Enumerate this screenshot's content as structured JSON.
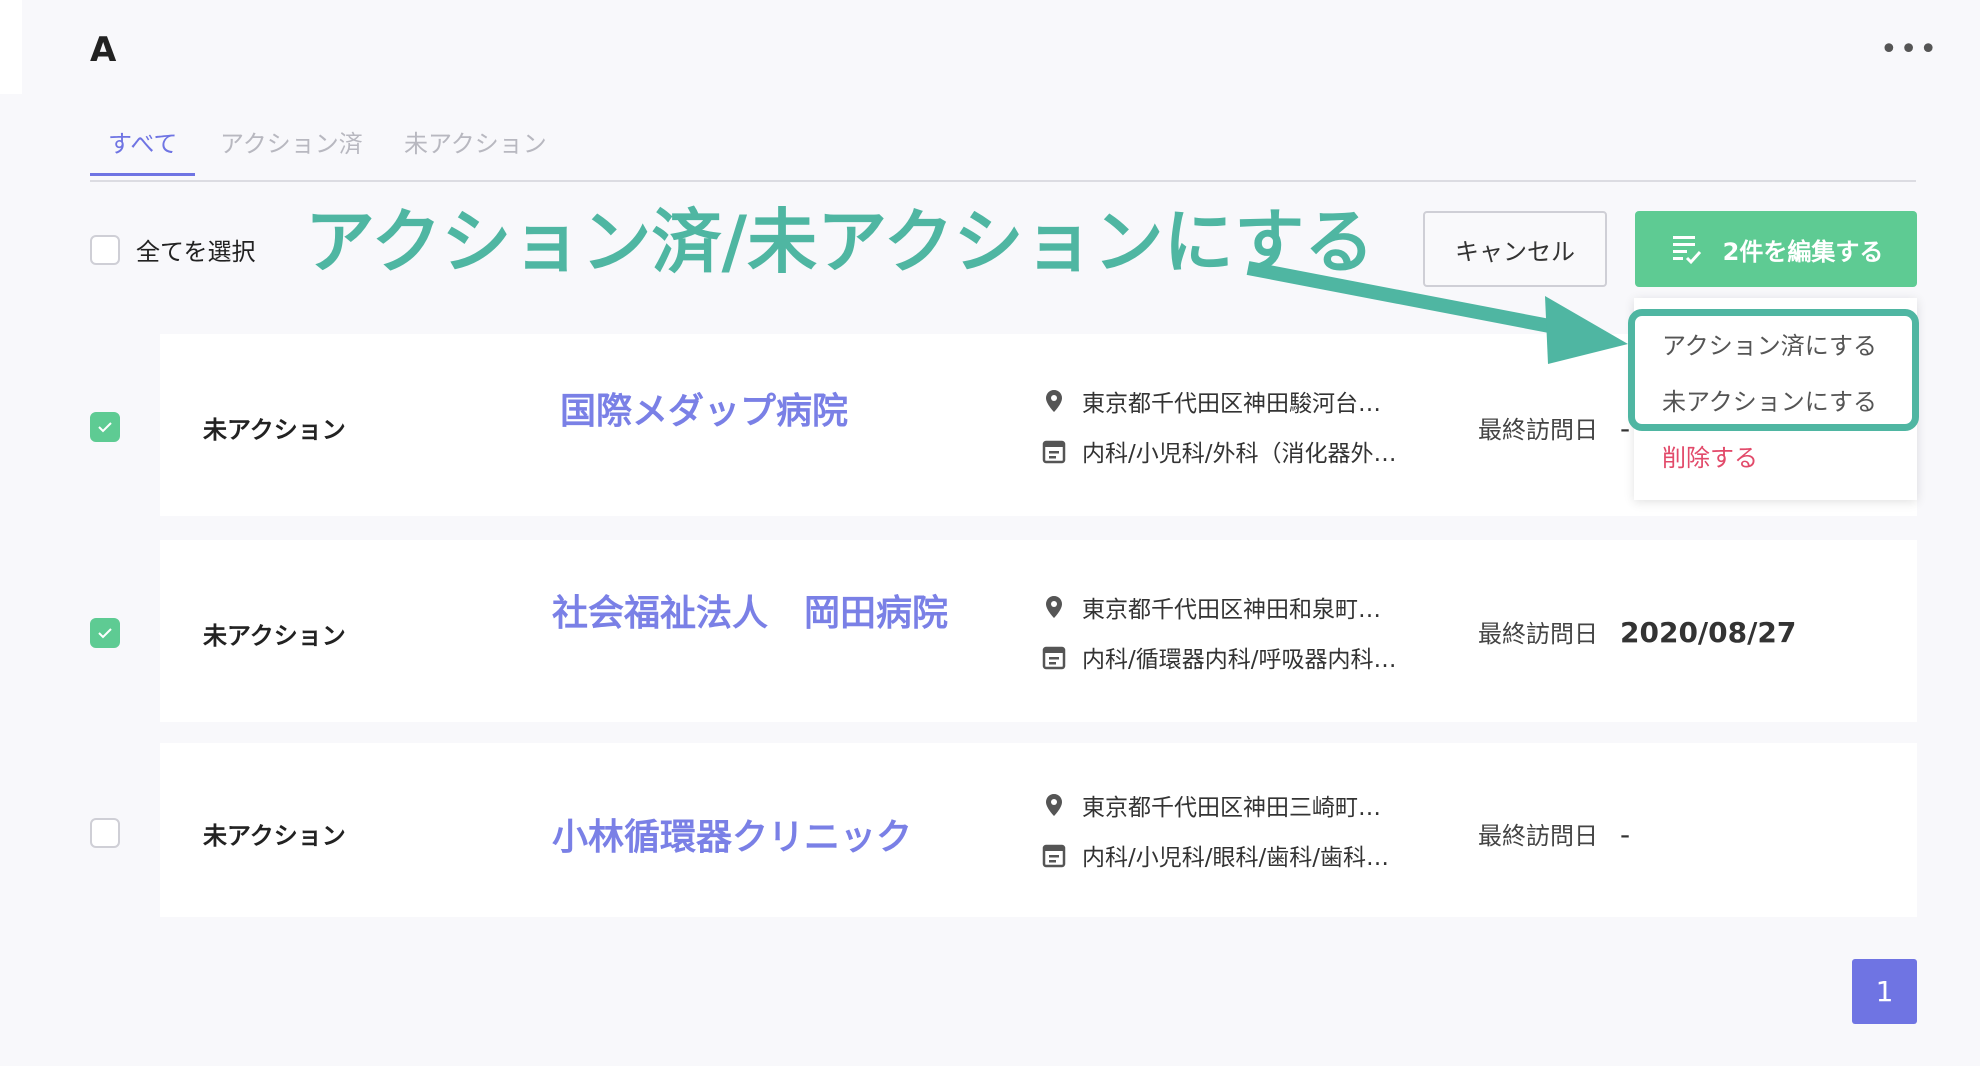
{
  "page": {
    "title": "A"
  },
  "tabs": [
    {
      "label": "すべて"
    },
    {
      "label": "アクション済"
    },
    {
      "label": "未アクション"
    }
  ],
  "toolbar": {
    "select_all_label": "全てを選択",
    "cancel_label": "キャンセル",
    "edit_label": "2件を編集する"
  },
  "annotation": {
    "headline": "アクション済/未アクションにする",
    "color": "#4fb6a2"
  },
  "dropdown": {
    "items": [
      {
        "label": "アクション済にする"
      },
      {
        "label": "未アクションにする"
      },
      {
        "label": "削除する"
      }
    ]
  },
  "rows": [
    {
      "checked": true,
      "status": "未アクション",
      "name": "国際メダップ病院",
      "address": "東京都千代田区神田駿河台…",
      "departments": "内科/小児科/外科（消化器外…",
      "visit_label": "最終訪問日",
      "visit_value": "-"
    },
    {
      "checked": true,
      "status": "未アクション",
      "name": "社会福祉法人　岡田病院",
      "address": "東京都千代田区神田和泉町…",
      "departments": "内科/循環器内科/呼吸器内科…",
      "visit_label": "最終訪問日",
      "visit_value": "2020/08/27"
    },
    {
      "checked": false,
      "status": "未アクション",
      "name": "小林循環器クリニック",
      "address": "東京都千代田区神田三崎町…",
      "departments": "内科/小児科/眼科/歯科/歯科…",
      "visit_label": "最終訪問日",
      "visit_value": "-"
    }
  ],
  "pagination": {
    "current": "1"
  },
  "colors": {
    "accent": "#6f74e3",
    "primary_green": "#5ecb93",
    "danger": "#e24a6a"
  }
}
